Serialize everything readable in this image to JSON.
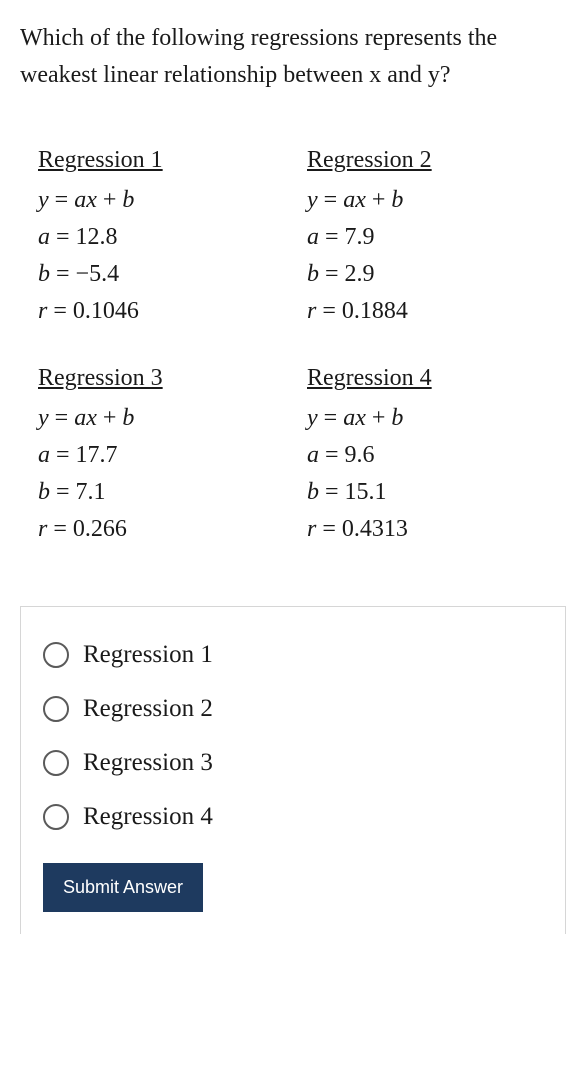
{
  "question": "Which of the following regressions represents the weakest linear relationship between x and y?",
  "regressions": [
    {
      "title": "Regression 1",
      "a": "12.8",
      "b": "−5.4",
      "r": "0.1046"
    },
    {
      "title": "Regression 2",
      "a": "7.9",
      "b": "2.9",
      "r": "0.1884"
    },
    {
      "title": "Regression 3",
      "a": "17.7",
      "b": "7.1",
      "r": "0.266"
    },
    {
      "title": "Regression 4",
      "a": "9.6",
      "b": "15.1",
      "r": "0.4313"
    }
  ],
  "options": [
    {
      "label": "Regression 1"
    },
    {
      "label": "Regression 2"
    },
    {
      "label": "Regression 3"
    },
    {
      "label": "Regression 4"
    }
  ],
  "submit_label": "Submit Answer"
}
